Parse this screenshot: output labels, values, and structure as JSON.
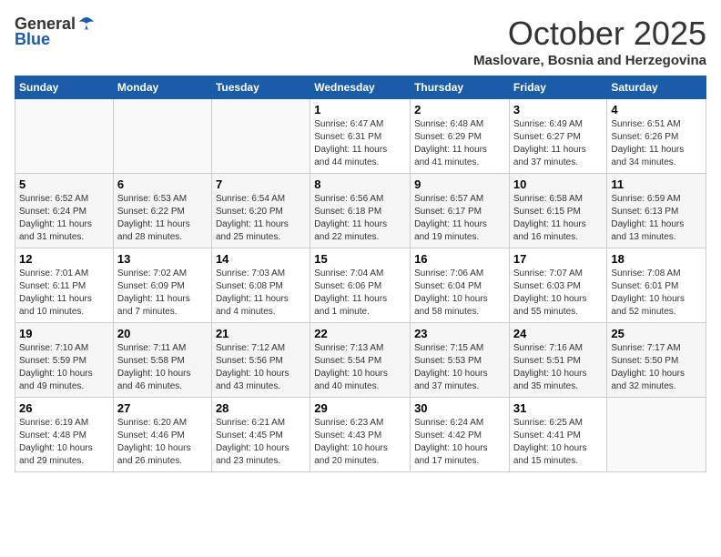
{
  "header": {
    "logo_general": "General",
    "logo_blue": "Blue",
    "month_title": "October 2025",
    "subtitle": "Maslovare, Bosnia and Herzegovina"
  },
  "days_of_week": [
    "Sunday",
    "Monday",
    "Tuesday",
    "Wednesday",
    "Thursday",
    "Friday",
    "Saturday"
  ],
  "weeks": [
    [
      {
        "day": "",
        "content": ""
      },
      {
        "day": "",
        "content": ""
      },
      {
        "day": "",
        "content": ""
      },
      {
        "day": "1",
        "content": "Sunrise: 6:47 AM\nSunset: 6:31 PM\nDaylight: 11 hours\nand 44 minutes."
      },
      {
        "day": "2",
        "content": "Sunrise: 6:48 AM\nSunset: 6:29 PM\nDaylight: 11 hours\nand 41 minutes."
      },
      {
        "day": "3",
        "content": "Sunrise: 6:49 AM\nSunset: 6:27 PM\nDaylight: 11 hours\nand 37 minutes."
      },
      {
        "day": "4",
        "content": "Sunrise: 6:51 AM\nSunset: 6:26 PM\nDaylight: 11 hours\nand 34 minutes."
      }
    ],
    [
      {
        "day": "5",
        "content": "Sunrise: 6:52 AM\nSunset: 6:24 PM\nDaylight: 11 hours\nand 31 minutes."
      },
      {
        "day": "6",
        "content": "Sunrise: 6:53 AM\nSunset: 6:22 PM\nDaylight: 11 hours\nand 28 minutes."
      },
      {
        "day": "7",
        "content": "Sunrise: 6:54 AM\nSunset: 6:20 PM\nDaylight: 11 hours\nand 25 minutes."
      },
      {
        "day": "8",
        "content": "Sunrise: 6:56 AM\nSunset: 6:18 PM\nDaylight: 11 hours\nand 22 minutes."
      },
      {
        "day": "9",
        "content": "Sunrise: 6:57 AM\nSunset: 6:17 PM\nDaylight: 11 hours\nand 19 minutes."
      },
      {
        "day": "10",
        "content": "Sunrise: 6:58 AM\nSunset: 6:15 PM\nDaylight: 11 hours\nand 16 minutes."
      },
      {
        "day": "11",
        "content": "Sunrise: 6:59 AM\nSunset: 6:13 PM\nDaylight: 11 hours\nand 13 minutes."
      }
    ],
    [
      {
        "day": "12",
        "content": "Sunrise: 7:01 AM\nSunset: 6:11 PM\nDaylight: 11 hours\nand 10 minutes."
      },
      {
        "day": "13",
        "content": "Sunrise: 7:02 AM\nSunset: 6:09 PM\nDaylight: 11 hours\nand 7 minutes."
      },
      {
        "day": "14",
        "content": "Sunrise: 7:03 AM\nSunset: 6:08 PM\nDaylight: 11 hours\nand 4 minutes."
      },
      {
        "day": "15",
        "content": "Sunrise: 7:04 AM\nSunset: 6:06 PM\nDaylight: 11 hours\nand 1 minute."
      },
      {
        "day": "16",
        "content": "Sunrise: 7:06 AM\nSunset: 6:04 PM\nDaylight: 10 hours\nand 58 minutes."
      },
      {
        "day": "17",
        "content": "Sunrise: 7:07 AM\nSunset: 6:03 PM\nDaylight: 10 hours\nand 55 minutes."
      },
      {
        "day": "18",
        "content": "Sunrise: 7:08 AM\nSunset: 6:01 PM\nDaylight: 10 hours\nand 52 minutes."
      }
    ],
    [
      {
        "day": "19",
        "content": "Sunrise: 7:10 AM\nSunset: 5:59 PM\nDaylight: 10 hours\nand 49 minutes."
      },
      {
        "day": "20",
        "content": "Sunrise: 7:11 AM\nSunset: 5:58 PM\nDaylight: 10 hours\nand 46 minutes."
      },
      {
        "day": "21",
        "content": "Sunrise: 7:12 AM\nSunset: 5:56 PM\nDaylight: 10 hours\nand 43 minutes."
      },
      {
        "day": "22",
        "content": "Sunrise: 7:13 AM\nSunset: 5:54 PM\nDaylight: 10 hours\nand 40 minutes."
      },
      {
        "day": "23",
        "content": "Sunrise: 7:15 AM\nSunset: 5:53 PM\nDaylight: 10 hours\nand 37 minutes."
      },
      {
        "day": "24",
        "content": "Sunrise: 7:16 AM\nSunset: 5:51 PM\nDaylight: 10 hours\nand 35 minutes."
      },
      {
        "day": "25",
        "content": "Sunrise: 7:17 AM\nSunset: 5:50 PM\nDaylight: 10 hours\nand 32 minutes."
      }
    ],
    [
      {
        "day": "26",
        "content": "Sunrise: 6:19 AM\nSunset: 4:48 PM\nDaylight: 10 hours\nand 29 minutes."
      },
      {
        "day": "27",
        "content": "Sunrise: 6:20 AM\nSunset: 4:46 PM\nDaylight: 10 hours\nand 26 minutes."
      },
      {
        "day": "28",
        "content": "Sunrise: 6:21 AM\nSunset: 4:45 PM\nDaylight: 10 hours\nand 23 minutes."
      },
      {
        "day": "29",
        "content": "Sunrise: 6:23 AM\nSunset: 4:43 PM\nDaylight: 10 hours\nand 20 minutes."
      },
      {
        "day": "30",
        "content": "Sunrise: 6:24 AM\nSunset: 4:42 PM\nDaylight: 10 hours\nand 17 minutes."
      },
      {
        "day": "31",
        "content": "Sunrise: 6:25 AM\nSunset: 4:41 PM\nDaylight: 10 hours\nand 15 minutes."
      },
      {
        "day": "",
        "content": ""
      }
    ]
  ]
}
